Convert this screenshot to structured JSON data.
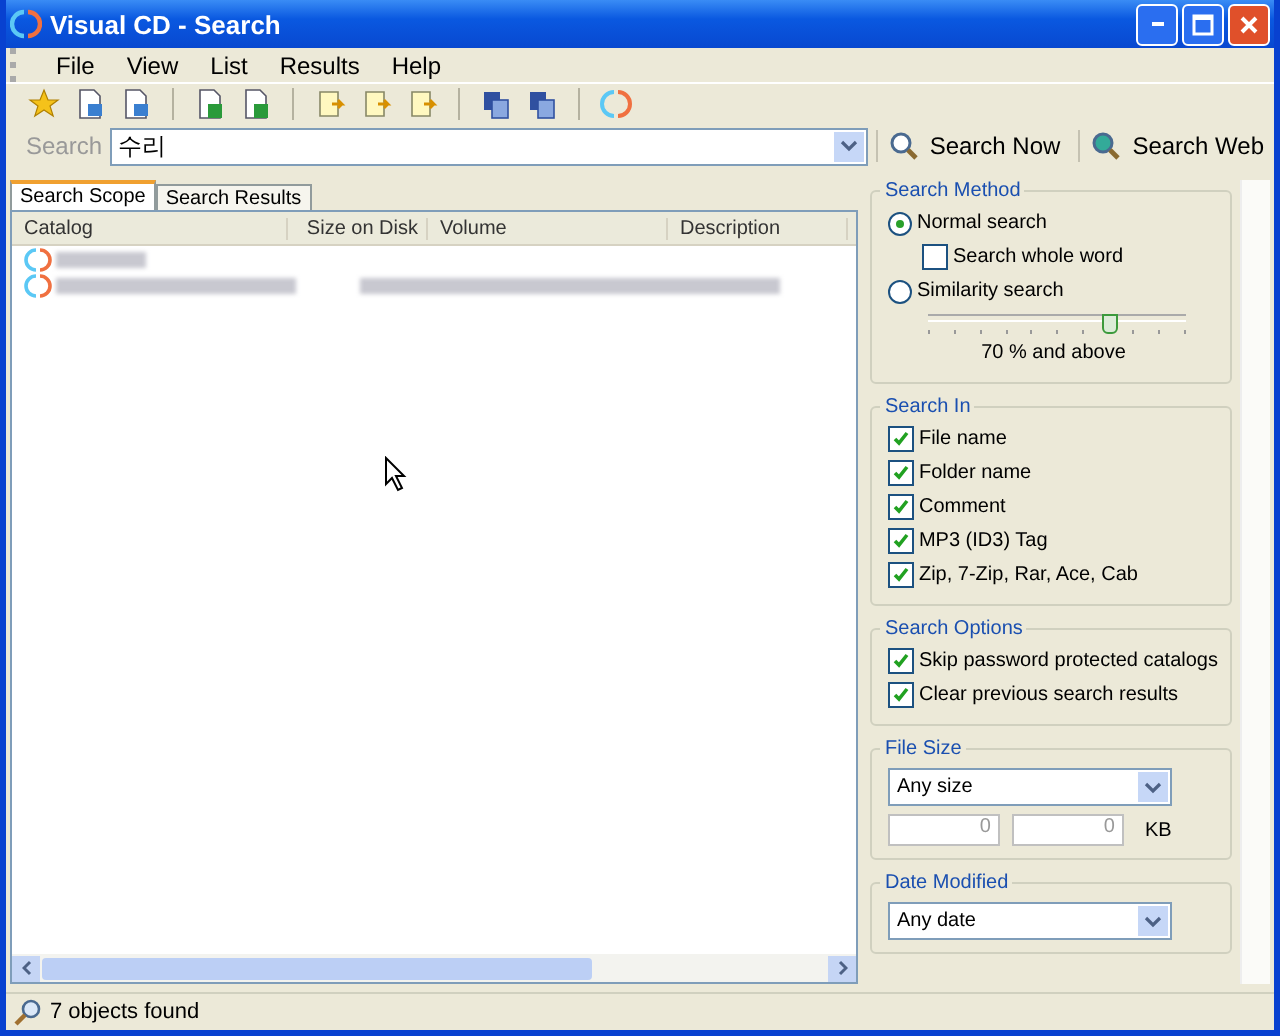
{
  "window": {
    "title": "Visual CD - Search"
  },
  "menu": [
    "File",
    "View",
    "List",
    "Results",
    "Help"
  ],
  "search_bar": {
    "label": "Search",
    "value": "수리",
    "buttons": [
      "Search Now",
      "Search Web"
    ]
  },
  "tabs": [
    {
      "label": "Search Scope",
      "selected": true
    },
    {
      "label": "Search Results",
      "selected": false
    }
  ],
  "table": {
    "columns": [
      "Catalog",
      "Size on Disk",
      "Volume",
      "Description"
    ],
    "rows": [
      {
        "kind": "redacted"
      },
      {
        "kind": "redacted"
      }
    ]
  },
  "status_bar": "7 objects found",
  "panel": {
    "search_method": {
      "title": "Search Method",
      "options": [
        {
          "label": "Normal search",
          "selected": true
        },
        {
          "label": "Similarity search",
          "selected": false
        }
      ],
      "whole_word": {
        "label": "Search whole word",
        "checked": false
      },
      "similarity": {
        "level": 0.7,
        "reading": "70 % and above"
      }
    },
    "search_in": {
      "title": "Search In",
      "items": [
        {
          "label": "File name",
          "checked": true
        },
        {
          "label": "Folder name",
          "checked": true
        },
        {
          "label": "Comment",
          "checked": true
        },
        {
          "label": "MP3 (ID3) Tag",
          "checked": true
        },
        {
          "label": "Zip, 7-Zip, Rar, Ace, Cab",
          "checked": true
        }
      ]
    },
    "search_options": {
      "title": "Search Options",
      "items": [
        {
          "label": "Skip password protected catalogs",
          "checked": true
        },
        {
          "label": "Clear previous search results",
          "checked": true
        }
      ]
    },
    "file_size": {
      "title": "File Size",
      "value": "Any size",
      "min": "0",
      "max": "0",
      "unit": "KB"
    },
    "date_modified": {
      "title": "Date Modified",
      "value": "Any date"
    }
  }
}
